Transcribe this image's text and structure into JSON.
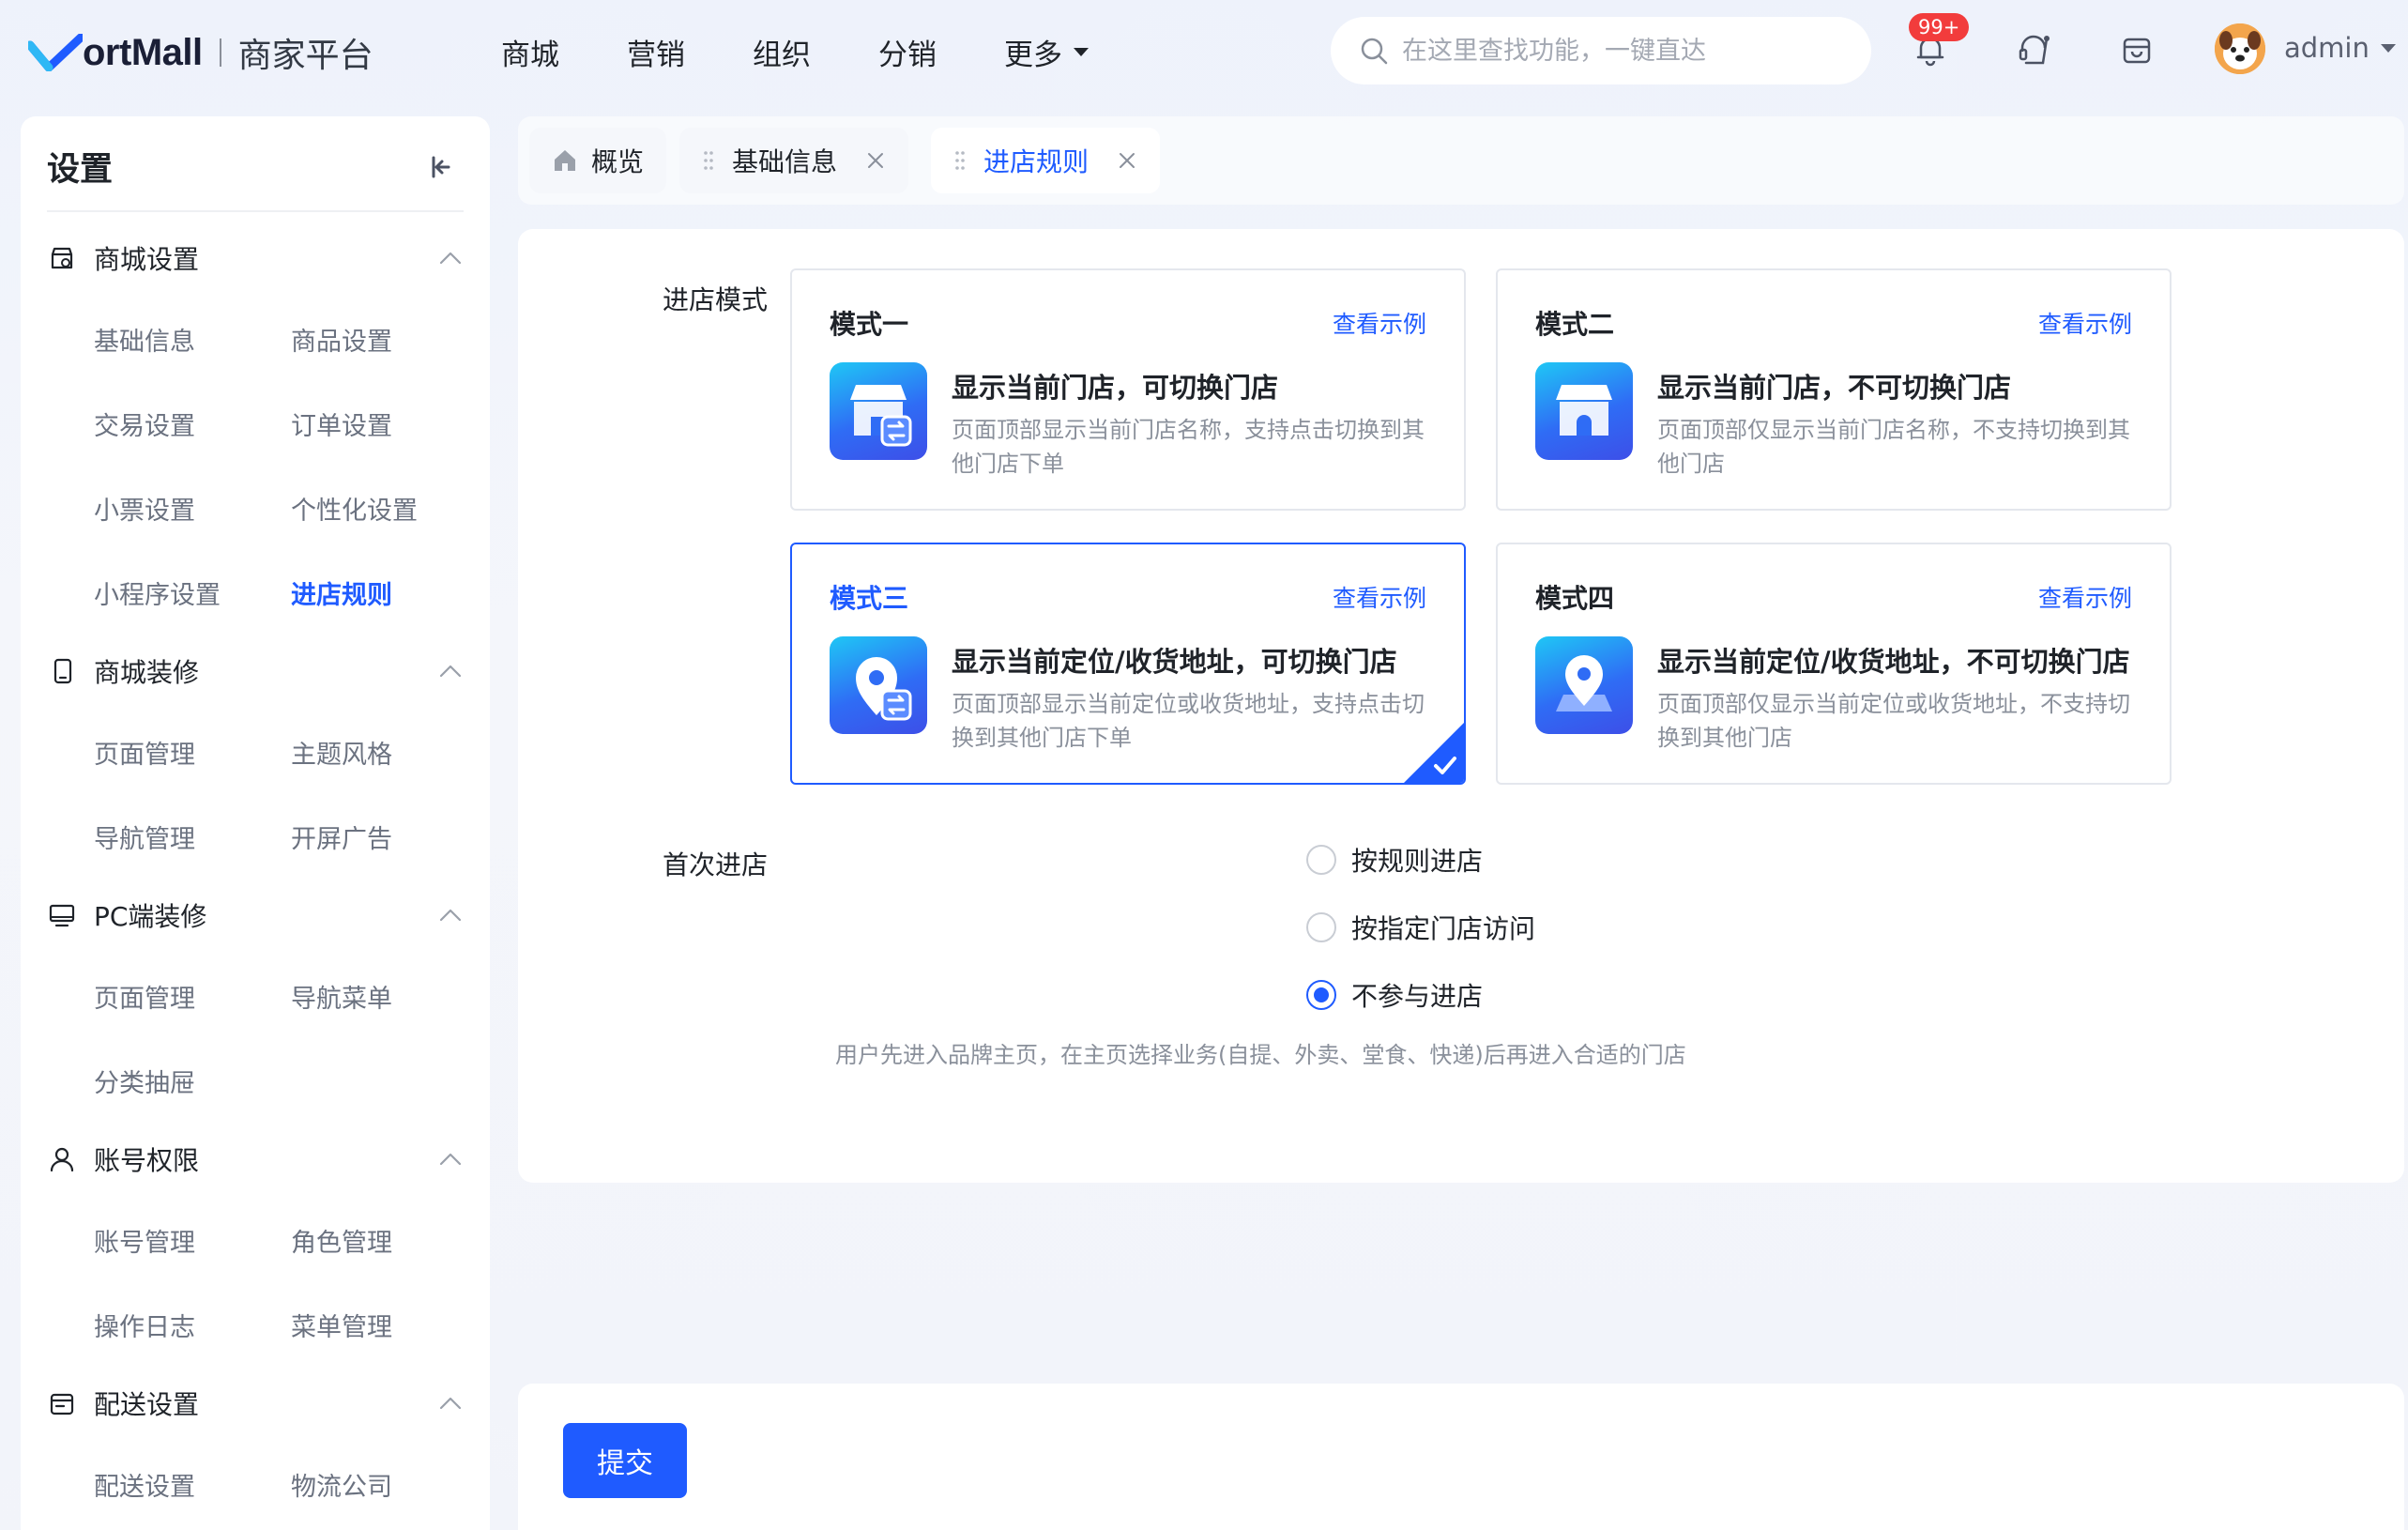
{
  "brand": {
    "name": "ortMall",
    "subtitle": "商家平台"
  },
  "nav": {
    "items": [
      "商城",
      "营销",
      "组织",
      "分销",
      "更多"
    ]
  },
  "search": {
    "placeholder": "在这里查找功能，一键直达"
  },
  "notifications": {
    "badge": "99+"
  },
  "user": {
    "name": "admin"
  },
  "sidebar": {
    "title": "设置",
    "groups": [
      {
        "label": "商城设置",
        "icon": "shop-settings-icon",
        "links": [
          "基础信息",
          "商品设置",
          "交易设置",
          "订单设置",
          "小票设置",
          "个性化设置",
          "小程序设置",
          "进店规则"
        ]
      },
      {
        "label": "商城装修",
        "icon": "mobile-decor-icon",
        "links": [
          "页面管理",
          "主题风格",
          "导航管理",
          "开屏广告"
        ]
      },
      {
        "label": "PC端装修",
        "icon": "monitor-icon",
        "links": [
          "页面管理",
          "导航菜单",
          "分类抽屉"
        ]
      },
      {
        "label": "账号权限",
        "icon": "user-icon",
        "links": [
          "账号管理",
          "角色管理",
          "操作日志",
          "菜单管理"
        ]
      },
      {
        "label": "配送设置",
        "icon": "delivery-icon",
        "links": [
          "配送设置",
          "物流公司"
        ]
      }
    ],
    "active_link": "进店规则"
  },
  "tabs": [
    {
      "label": "概览"
    },
    {
      "label": "基础信息"
    },
    {
      "label": "进店规则"
    }
  ],
  "form": {
    "mode_label": "进店模式",
    "view_example": "查看示例",
    "modes": [
      {
        "title": "模式一",
        "heading": "显示当前门店，可切换门店",
        "desc": "页面顶部显示当前门店名称，支持点击切换到其他门店下单"
      },
      {
        "title": "模式二",
        "heading": "显示当前门店，不可切换门店",
        "desc": "页面顶部仅显示当前门店名称，不支持切换到其他门店"
      },
      {
        "title": "模式三",
        "heading": "显示当前定位/收货地址，可切换门店",
        "desc": "页面顶部显示当前定位或收货地址，支持点击切换到其他门店下单"
      },
      {
        "title": "模式四",
        "heading": "显示当前定位/收货地址，不可切换门店",
        "desc": "页面顶部仅显示当前定位或收货地址，不支持切换到其他门店"
      }
    ],
    "selected_mode": "模式三",
    "first_entry_label": "首次进店",
    "first_entry_options": [
      "按规则进店",
      "按指定门店访问",
      "不参与进店"
    ],
    "first_entry_selected": "不参与进店",
    "first_entry_hint": "用户先进入品牌主页，在主页选择业务(自提、外卖、堂食、快递)后再进入合适的门店"
  },
  "footer": {
    "submit_label": "提交"
  },
  "colors": {
    "accent": "#1f5bff",
    "badge": "#f23c3c",
    "text": "#1f2329",
    "muted": "#8a909b"
  }
}
